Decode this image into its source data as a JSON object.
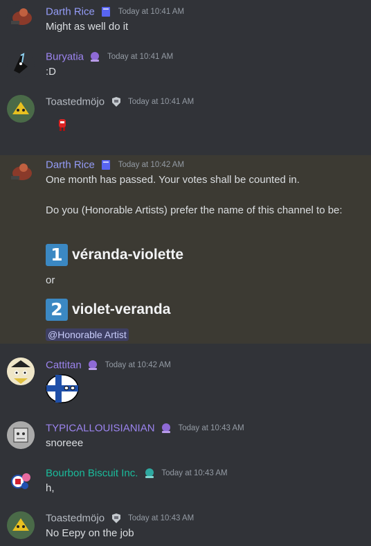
{
  "messages": [
    {
      "user": "Darth Rice",
      "user_color": "#949cf7",
      "time": "Today at 10:41 AM",
      "text": "Might as well do it",
      "badge": "book-badge-icon"
    },
    {
      "user": "Buryatia",
      "user_color": "#9c84ef",
      "time": "Today at 10:41 AM",
      "text": ":D",
      "badge": "crystal-ball-badge-icon"
    },
    {
      "user": "Toastedmöjo",
      "user_color": "#b5bac1",
      "time": "Today at 10:41 AM",
      "text": "",
      "badge": "shield-badge-icon"
    },
    {
      "user": "Darth Rice",
      "user_color": "#949cf7",
      "time": "Today at 10:42 AM",
      "badge": "book-badge-icon",
      "line1": "One month has passed. Your votes shall be counted in.",
      "line2": "Do you (Honorable Artists) prefer the name of this channel to be:",
      "option1_num": "1",
      "option1": "véranda-violette",
      "or": "or",
      "option2_num": "2",
      "option2": "violet-veranda",
      "mention": "@Honorable Artist"
    },
    {
      "user": "Cattitan",
      "user_color": "#9c84ef",
      "time": "Today at 10:42 AM",
      "text": "",
      "badge": "crystal-ball-badge-icon"
    },
    {
      "user": "TYPICALLOUISIANIAN",
      "user_color": "#9c84ef",
      "time": "Today at 10:43 AM",
      "text": "snoreee",
      "badge": "crystal-ball-badge-icon"
    },
    {
      "user": "Bourbon Biscuit Inc.",
      "user_color": "#1abc9c",
      "time": "Today at 10:43 AM",
      "text": "h,",
      "badge": "crystal-ball-badge-icon"
    },
    {
      "user": "Toastedmöjo",
      "user_color": "#b5bac1",
      "time": "Today at 10:43 AM",
      "text": "No Eepy on the job",
      "badge": "shield-badge-icon"
    }
  ]
}
